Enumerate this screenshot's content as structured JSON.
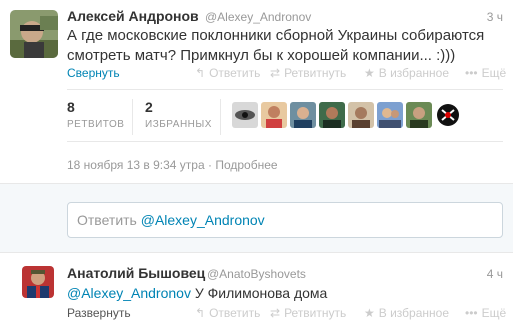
{
  "main_tweet": {
    "name": "Алексей Андронов",
    "handle": "@Alexey_Andronov",
    "time": "3 ч",
    "text": "А где московские поклонники сборной Украины собираются смотреть матч? Примкнул бы к хорошей компании... :)))",
    "collapse_label": "Свернуть",
    "actions": {
      "reply": "Ответить",
      "retweet": "Ретвитнуть",
      "favorite": "В избранное",
      "more": "Ещё"
    },
    "stats": {
      "retweets_count": "8",
      "retweets_label": "РЕТВИТОВ",
      "favorites_count": "2",
      "favorites_label": "ИЗБРАННЫХ"
    },
    "date": "18 ноября 13 в 9:34 утра · Подробнее"
  },
  "reply_box": {
    "placeholder_prefix": "Ответить",
    "mention": "@Alexey_Andronov"
  },
  "reply_tweet": {
    "name": "Анатолий Бышовец",
    "handle": "@AnatoByshovets",
    "time": "4 ч",
    "mention": "@Alexey_Andronov",
    "text": "У Филимонова дома",
    "expand_label": "Развернуть",
    "actions": {
      "reply": "Ответить",
      "retweet": "Ретвитнуть",
      "favorite": "В избранное",
      "more": "Ещё"
    }
  },
  "colors": {
    "link": "#0084b4",
    "muted": "#999999",
    "action_muted": "#cccccc",
    "text": "#333333"
  }
}
